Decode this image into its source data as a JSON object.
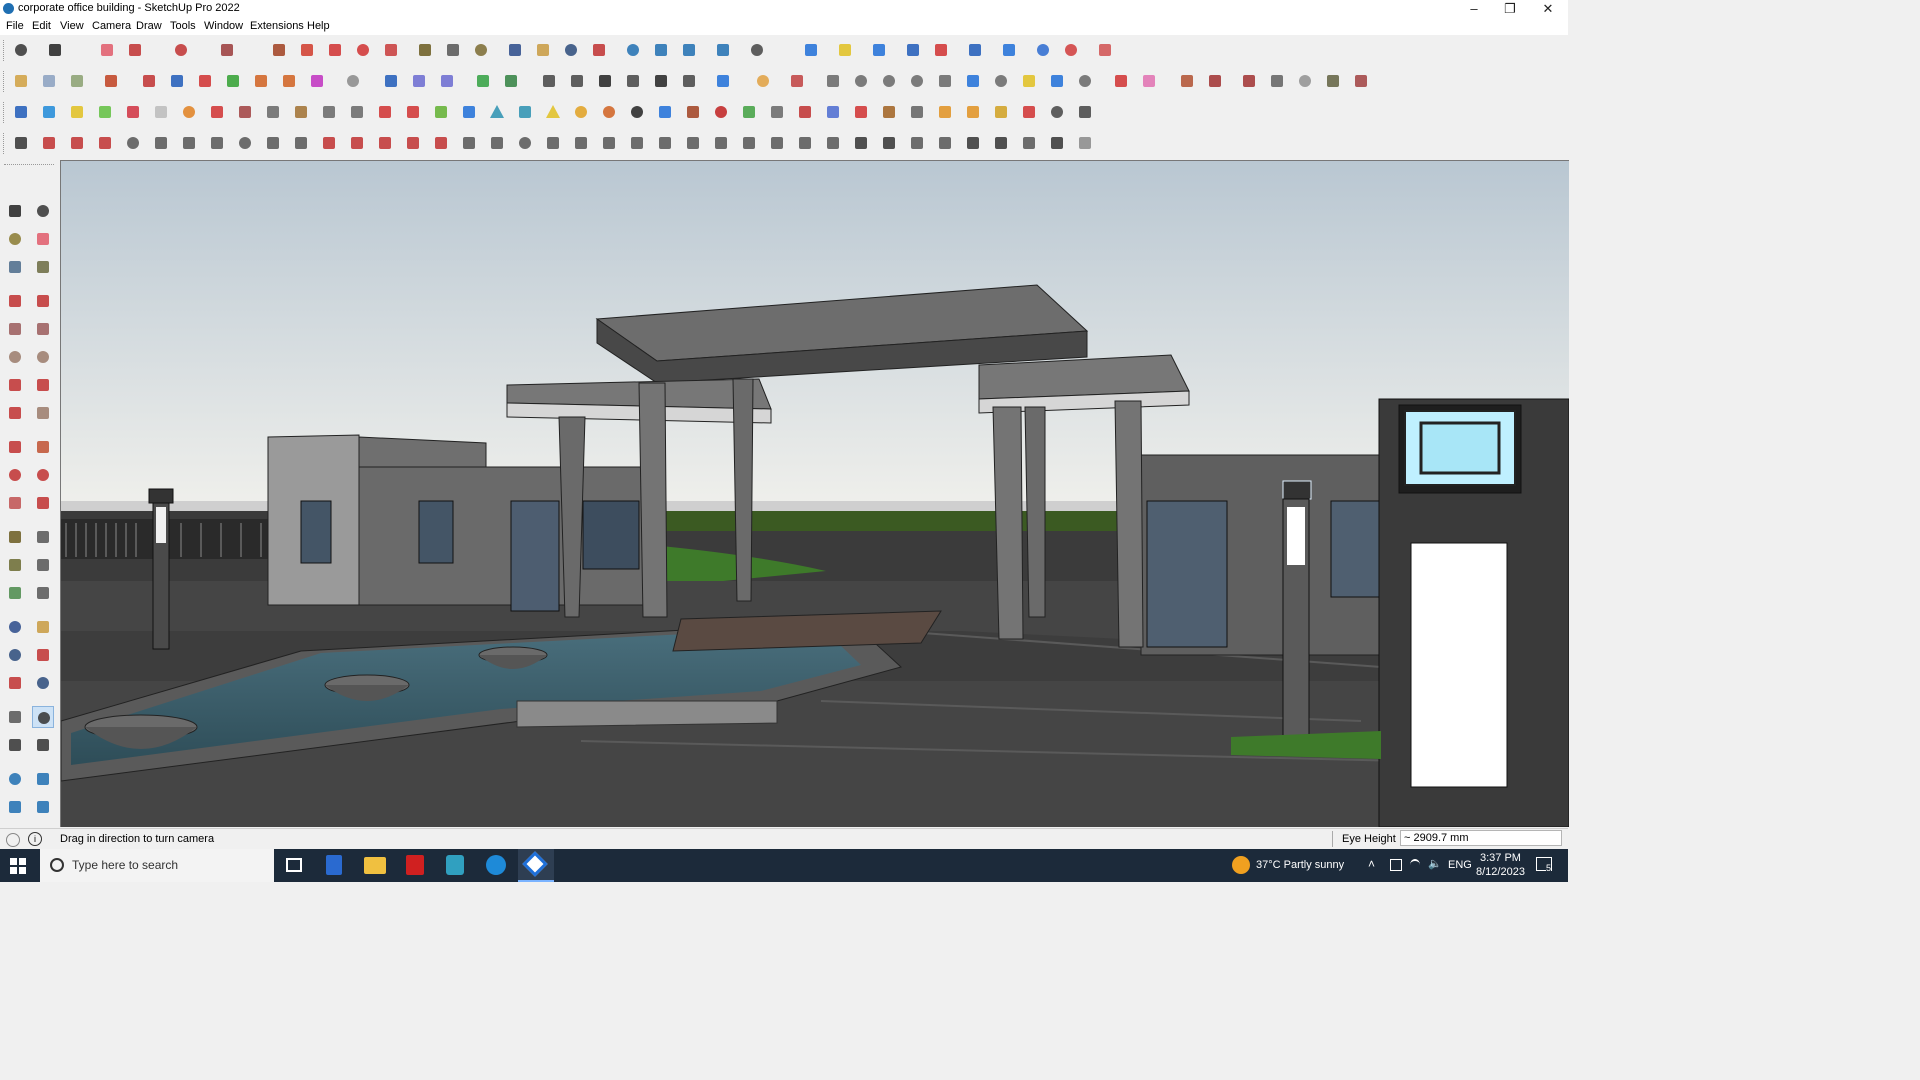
{
  "window": {
    "title": "corporate office building - SketchUp Pro 2022"
  },
  "menu": [
    "File",
    "Edit",
    "View",
    "Camera",
    "Draw",
    "Tools",
    "Window",
    "Extensions",
    "Help"
  ],
  "status": {
    "hint": "Drag in direction to turn camera",
    "measure_label": "Eye Height",
    "measure_value": "~ 2909.7 mm"
  },
  "taskbar": {
    "search_placeholder": "Type here to search",
    "weather": "37°C  Partly sunny",
    "language": "ENG",
    "time": "3:37 PM",
    "date": "8/12/2023",
    "notification_count": "5"
  },
  "icons": {
    "window_controls": [
      "minimize-icon",
      "maximize-icon",
      "close-icon"
    ],
    "taskbar_apps": [
      "task-view-icon",
      "calculator-icon",
      "file-explorer-icon",
      "acrobat-icon",
      "app-3-icon",
      "edge-icon",
      "sketchup-icon"
    ]
  }
}
